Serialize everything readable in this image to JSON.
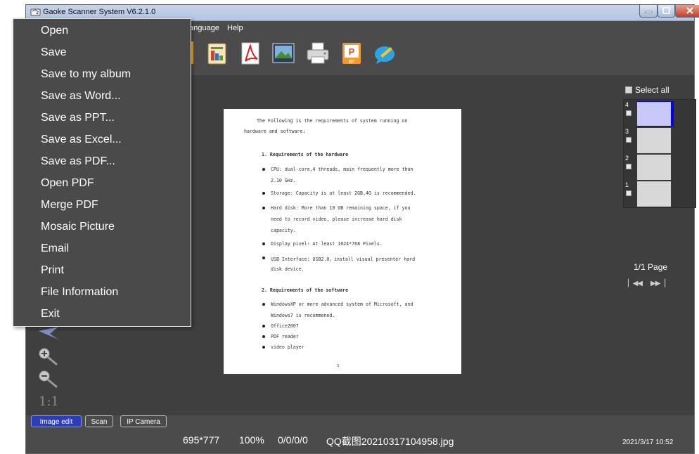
{
  "window": {
    "title": "Gaoke Scanner System V6.2.1.0"
  },
  "menubar": {
    "items": [
      "anguage",
      "Help"
    ]
  },
  "file_menu": {
    "items": [
      "Open",
      "Save",
      "Save to my album",
      "Save as Word...",
      "Save as PPT...",
      "Save as Excel...",
      "Save as PDF...",
      "Open PDF",
      "Merge PDF",
      "Mosaic Picture",
      "Email",
      "Print",
      "File Information",
      "Exit"
    ]
  },
  "toolbar": {
    "icons": [
      "excel-icon",
      "pdf-icon",
      "picture-icon",
      "printer-icon",
      "ppt-icon",
      "comment-icon"
    ],
    "ppt_label": "ppt"
  },
  "document": {
    "intro_line1": "The Following is the requirements of system running on",
    "intro_line2": "hardware and software:",
    "section1": "1. Requirements of the hardware",
    "s1_b1_l1": "CPU: dual-core,4 threads, main frequently more than",
    "s1_b1_l2": "2.10 GHz.",
    "s1_b2": "Storage: Capacity is at least 2GB,4G is recommended.",
    "s1_b3_l1": "Hard disk: More than 10 GB remaining space, if you",
    "s1_b3_l2": "need to record video, please increase hard disk",
    "s1_b3_l3": "capacity.",
    "s1_b4": "Display pixel: At least 1024*768 Pixels.",
    "s1_b5_l1": "USB Interface: USB2.0，install  visual presenter hard",
    "s1_b5_l2": "disk device.",
    "section2": "2. Requirements of the software",
    "s2_b1_l1": "WindowsXP or more advanced system of Microsoft, and",
    "s2_b1_l2": "Windows7 is recommened.",
    "s2_b2": "Office2007",
    "s2_b3": "PDF reader",
    "s2_b4": "video player",
    "page_number": "3"
  },
  "left_tools": {
    "fit_label": "1:1"
  },
  "right_panel": {
    "select_all": "Select all",
    "thumbnails": [
      {
        "num": "4",
        "selected": true
      },
      {
        "num": "3",
        "selected": false
      },
      {
        "num": "2",
        "selected": false
      },
      {
        "num": "1",
        "selected": false
      }
    ],
    "page_count": "1/1 Page",
    "nav_first": "▏◀◀",
    "nav_last": "▶▶▕"
  },
  "bottom_tabs": [
    "Image edit",
    "Scan",
    "IP Camera"
  ],
  "status": {
    "dimensions": "695*777",
    "zoom": "100%",
    "coords": "0/0/0/0",
    "filename": "QQ截图20210317104958.jpg",
    "datetime": "2021/3/17 10:52"
  },
  "colors": {
    "accent": "#2d3cb7",
    "thumb_selected": "#c8c8fb",
    "thumb_border": "#0000ee"
  }
}
